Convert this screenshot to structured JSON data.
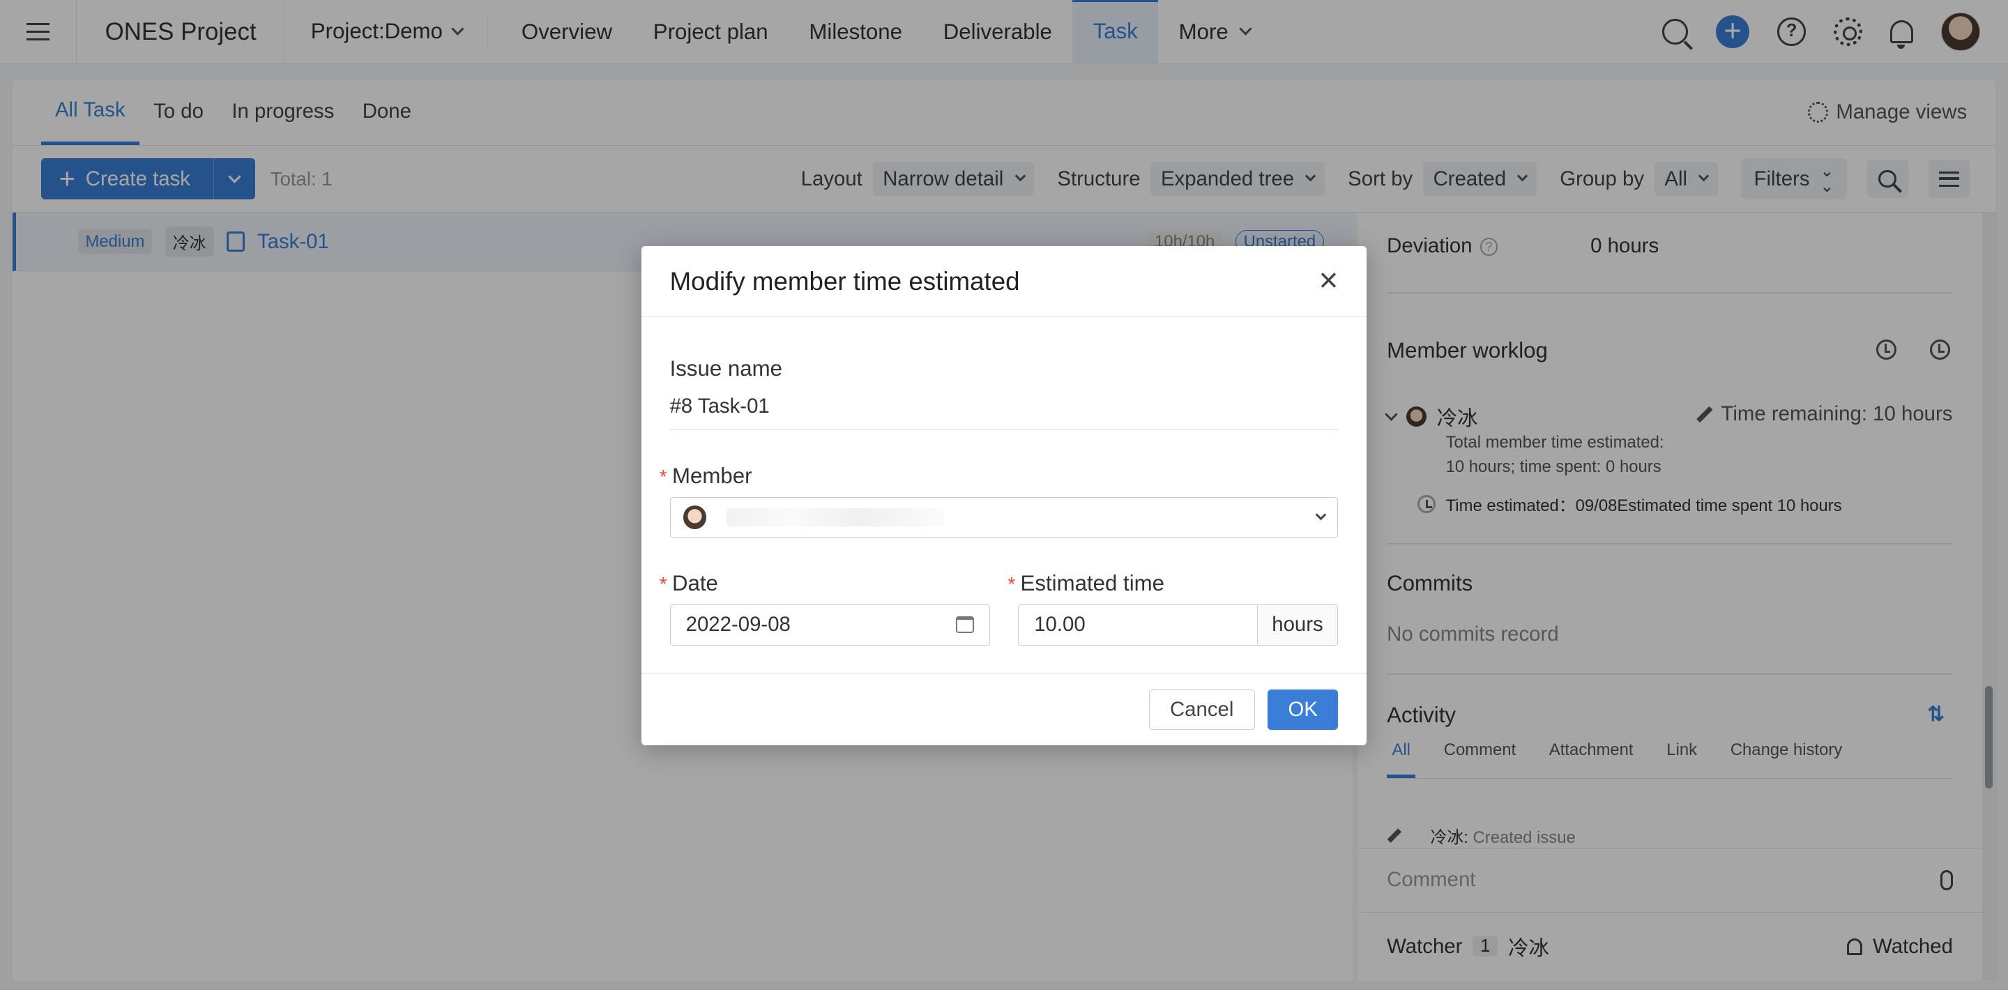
{
  "topbar": {
    "app_name": "ONES Project",
    "project": "Project:Demo",
    "nav": [
      "Overview",
      "Project plan",
      "Milestone",
      "Deliverable",
      "Task"
    ],
    "more": "More"
  },
  "viewtabs": {
    "tabs": [
      "All Task",
      "To do",
      "In progress",
      "Done"
    ],
    "manage_views": "Manage views"
  },
  "toolbar": {
    "create_task": "Create task",
    "total": "Total: 1",
    "layout_label": "Layout",
    "layout_value": "Narrow detail",
    "structure_label": "Structure",
    "structure_value": "Expanded tree",
    "sort_label": "Sort by",
    "sort_value": "Created",
    "group_label": "Group by",
    "group_value": "All",
    "filters": "Filters"
  },
  "task": {
    "priority": "Medium",
    "assignee": "冷冰",
    "title": "Task-01",
    "time": "10h/10h",
    "status": "Unstarted"
  },
  "detail": {
    "deviation_label": "Deviation",
    "deviation_value": "0 hours",
    "worklog_title": "Member worklog",
    "member_name": "冷冰",
    "time_remaining": "Time remaining: 10 hours",
    "total_line1": "Total member time estimated:",
    "total_line2": "10 hours; time spent: 0 hours",
    "time_estimated": "Time estimated：09/08Estimated time spent 10 hours",
    "commits_title": "Commits",
    "no_commits": "No commits record",
    "activity_title": "Activity",
    "activity_tabs": [
      "All",
      "Comment",
      "Attachment",
      "Link",
      "Change history"
    ],
    "activity_user": "冷冰:",
    "activity_text": "Created issue",
    "comment_placeholder": "Comment",
    "watcher_label": "Watcher",
    "watcher_count": "1",
    "watcher_name": "冷冰",
    "watched": "Watched"
  },
  "modal": {
    "title": "Modify member time estimated",
    "issue_name_label": "Issue name",
    "issue_name_value": "#8 Task-01",
    "member_label": "Member",
    "date_label": "Date",
    "date_value": "2022-09-08",
    "estimated_label": "Estimated time",
    "estimated_value": "10.00",
    "estimated_unit": "hours",
    "cancel": "Cancel",
    "ok": "OK"
  }
}
